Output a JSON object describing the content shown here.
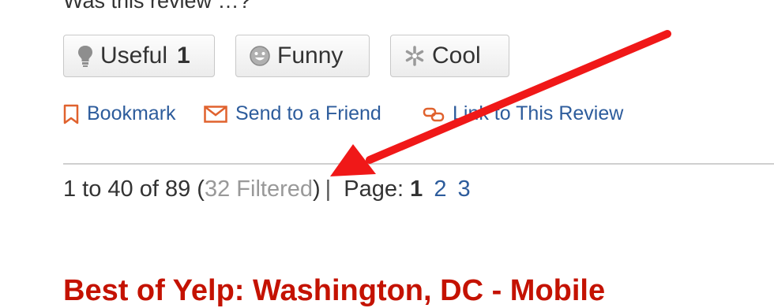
{
  "review_feedback": {
    "question": "Was this review …?",
    "buttons": [
      {
        "label": "Useful",
        "count": "1",
        "icon": "lightbulb-icon"
      },
      {
        "label": "Funny",
        "icon": "smiley-icon"
      },
      {
        "label": "Cool",
        "icon": "snowflake-icon"
      }
    ]
  },
  "actions": {
    "bookmark": "Bookmark",
    "send": "Send to a Friend",
    "link": "Link to This Review",
    "icon_color": "#e0622e",
    "link_color": "#2d5c9c"
  },
  "pagination": {
    "range": "1 to 40 of 89 (",
    "filtered": "32 Filtered",
    "close": ")",
    "separator": "|",
    "page_label": "Page:",
    "current_page": "1",
    "pages": [
      "2",
      "3"
    ]
  },
  "section_heading": "Best of Yelp: Washington, DC - Mobile",
  "annotation": {
    "type": "arrow",
    "color": "#f01818"
  }
}
